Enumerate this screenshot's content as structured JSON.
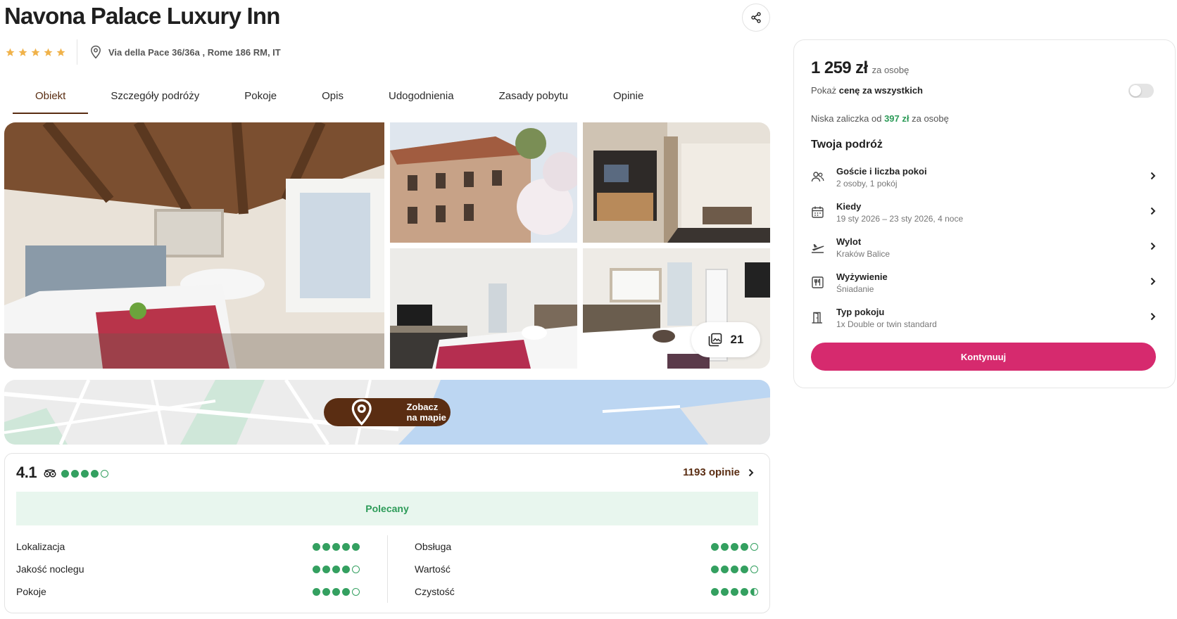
{
  "hotel": {
    "name": "Navona Palace Luxury Inn",
    "stars": 5,
    "address": "Via della Pace 36/36a , Rome 186 RM, IT"
  },
  "tabs": [
    {
      "label": "Obiekt",
      "active": true
    },
    {
      "label": "Szczegóły podróży",
      "active": false
    },
    {
      "label": "Pokoje",
      "active": false
    },
    {
      "label": "Opis",
      "active": false
    },
    {
      "label": "Udogodnienia",
      "active": false
    },
    {
      "label": "Zasady pobytu",
      "active": false
    },
    {
      "label": "Opinie",
      "active": false
    }
  ],
  "gallery": {
    "photo_count": "21",
    "photos": [
      "hotel-room-photo",
      "building-exterior-photo",
      "lobby-photo",
      "bedroom-photo",
      "twin-room-photo"
    ]
  },
  "map": {
    "button_label": "Zobacz na mapie"
  },
  "reviews": {
    "score": "4.1",
    "tripadvisor_rating": 4,
    "count_label": "1193 opinie",
    "banner": "Polecany",
    "categories_left": [
      {
        "label": "Lokalizacja",
        "rating": 5
      },
      {
        "label": "Jakość noclegu",
        "rating": 4
      },
      {
        "label": "Pokoje",
        "rating": 4
      }
    ],
    "categories_right": [
      {
        "label": "Obsługa",
        "rating": 4
      },
      {
        "label": "Wartość",
        "rating": 4
      },
      {
        "label": "Czystość",
        "rating": 4.5
      }
    ]
  },
  "booking": {
    "price": "1 259 zł",
    "price_suffix": "za osobę",
    "show_all_prefix": "Pokaż",
    "show_all_bold": "cenę za wszystkich",
    "deposit_prefix": "Niska zaliczka od",
    "deposit_amount": "397 zł",
    "deposit_suffix": "za osobę",
    "trip_heading": "Twoja podróż",
    "trip_items": [
      {
        "icon": "guests-icon",
        "title": "Goście i liczba pokoi",
        "subtitle": "2 osoby, 1 pokój"
      },
      {
        "icon": "calendar-icon",
        "title": "Kiedy",
        "subtitle": "19 sty 2026 – 23 sty 2026, 4 noce"
      },
      {
        "icon": "plane-icon",
        "title": "Wylot",
        "subtitle": "Kraków Balice"
      },
      {
        "icon": "meal-icon",
        "title": "Wyżywienie",
        "subtitle": "Śniadanie"
      },
      {
        "icon": "door-icon",
        "title": "Typ pokoju",
        "subtitle": "1x Double or twin standard"
      }
    ],
    "cta_label": "Kontynuuj"
  },
  "colors": {
    "brand_brown": "#5a2d12",
    "accent_pink": "#d62a6e",
    "rating_green": "#34a060",
    "star_gold": "#f0b24a"
  }
}
